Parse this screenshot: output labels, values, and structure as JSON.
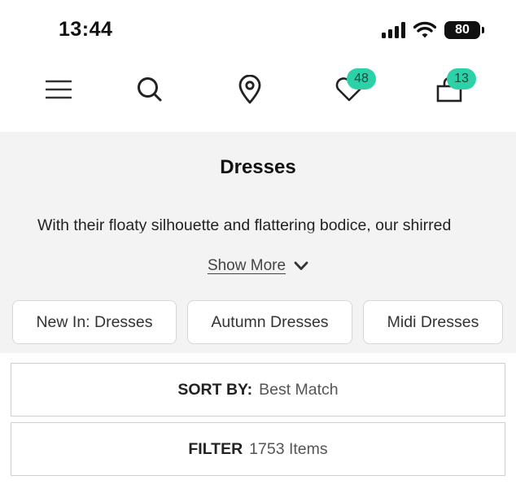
{
  "status_bar": {
    "time": "13:44",
    "battery_level": "80"
  },
  "nav": {
    "icons": [
      "menu-icon",
      "search-icon",
      "location-pin-icon",
      "heart-icon",
      "bag-icon"
    ],
    "wishlist_count": "48",
    "bag_count": "13"
  },
  "category": {
    "title": "Dresses",
    "description": "With their floaty silhouette and flattering bodice, our shirred",
    "show_more_label": "Show More"
  },
  "chips": [
    "New In: Dresses",
    "Autumn Dresses",
    "Midi Dresses"
  ],
  "sort": {
    "label": "SORT BY:",
    "value": "Best Match"
  },
  "filter": {
    "label": "FILTER",
    "count": "1753 Items"
  },
  "colors": {
    "badge": "#2cd1a8",
    "panel_background": "#f3f3f3",
    "border": "#cfcfcf"
  }
}
